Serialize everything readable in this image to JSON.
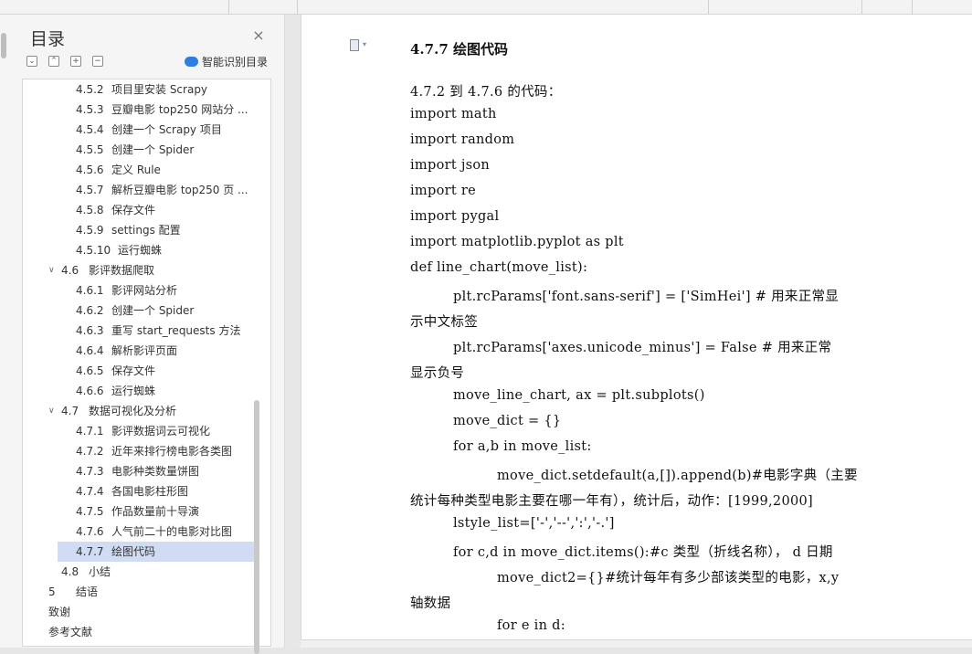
{
  "nav": {
    "title": "目录",
    "smart_toc_label": "智能识别目录",
    "items": [
      {
        "num": "4.5.2",
        "label": "项目里安装 Scrapy",
        "level": 3
      },
      {
        "num": "4.5.3",
        "label": "豆瓣电影 top250 网站分 ...",
        "level": 3
      },
      {
        "num": "4.5.4",
        "label": "创建一个 Scrapy 项目",
        "level": 3
      },
      {
        "num": "4.5.5",
        "label": "创建一个 Spider",
        "level": 3
      },
      {
        "num": "4.5.6",
        "label": "定义 Rule",
        "level": 3
      },
      {
        "num": "4.5.7",
        "label": "解析豆瓣电影 top250 页 ...",
        "level": 3
      },
      {
        "num": "4.5.8",
        "label": "保存文件",
        "level": 3
      },
      {
        "num": "4.5.9",
        "label": "settings 配置",
        "level": 3
      },
      {
        "num": "4.5.10",
        "label": "运行蜘蛛",
        "level": 3
      },
      {
        "num": "4.6",
        "label": "影评数据爬取",
        "level": 2,
        "expanded": true
      },
      {
        "num": "4.6.1",
        "label": "影评网站分析",
        "level": 3
      },
      {
        "num": "4.6.2",
        "label": "创建一个 Spider",
        "level": 3
      },
      {
        "num": "4.6.3",
        "label": "重写 start_requests 方法",
        "level": 3
      },
      {
        "num": "4.6.4",
        "label": "解析影评页面",
        "level": 3
      },
      {
        "num": "4.6.5",
        "label": "保存文件",
        "level": 3
      },
      {
        "num": "4.6.6",
        "label": "运行蜘蛛",
        "level": 3
      },
      {
        "num": "4.7",
        "label": "数据可视化及分析",
        "level": 2,
        "expanded": true
      },
      {
        "num": "4.7.1",
        "label": "影评数据词云可视化",
        "level": 3
      },
      {
        "num": "4.7.2",
        "label": "近年来排行榜电影各类图",
        "level": 3
      },
      {
        "num": "4.7.3",
        "label": "电影种类数量饼图",
        "level": 3
      },
      {
        "num": "4.7.4",
        "label": "各国电影柱形图",
        "level": 3
      },
      {
        "num": "4.7.5",
        "label": "作品数量前十导演",
        "level": 3
      },
      {
        "num": "4.7.6",
        "label": "人气前二十的电影对比图",
        "level": 3
      },
      {
        "num": "4.7.7",
        "label": "绘图代码",
        "level": 3,
        "selected": true
      },
      {
        "num": "4.8",
        "label": "小结",
        "level": 2
      },
      {
        "num": "5",
        "label": "结语",
        "level": 1
      },
      {
        "num": "",
        "label": "致谢",
        "level": 1
      },
      {
        "num": "",
        "label": "参考文献",
        "level": 1
      }
    ]
  },
  "doc": {
    "heading": "4.7.7   绘图代码",
    "lines": [
      {
        "text": "4.7.2 到 4.7.6 的代码：",
        "indent": 0
      },
      {
        "text": "import math",
        "indent": 0
      },
      {
        "text": "import random",
        "indent": 0
      },
      {
        "text": "import json",
        "indent": 0
      },
      {
        "text": "import re",
        "indent": 0
      },
      {
        "text": "import pygal",
        "indent": 0
      },
      {
        "text": "import matplotlib.pyplot as plt",
        "indent": 0
      },
      {
        "text": "def line_chart(move_list):",
        "indent": 0
      },
      {
        "text": "plt.rcParams['font.sans-serif'] = ['SimHei']    # 用来正常显",
        "indent": 1
      },
      {
        "text": "示中文标签",
        "indent": 0
      },
      {
        "text": "plt.rcParams['axes.unicode_minus'] = False    # 用来正常",
        "indent": 1
      },
      {
        "text": "显示负号",
        "indent": 0
      },
      {
        "text": "move_line_chart, ax = plt.subplots()",
        "indent": 1
      },
      {
        "text": "move_dict = {}",
        "indent": 1
      },
      {
        "text": "for a,b in move_list:",
        "indent": 1
      },
      {
        "text": "move_dict.setdefault(a,[]).append(b)#电影字典（主要",
        "indent": 2
      },
      {
        "text": "统计每种类型电影主要在哪一年有），统计后，动作：[1999,2000]",
        "indent": 0
      },
      {
        "text": "lstyle_list=['-','--',':','-.']",
        "indent": 1
      },
      {
        "text": "for c,d in move_dict.items():#c 类型（折线名称）， d 日期",
        "indent": 1
      },
      {
        "text": "move_dict2={}#统计每年有多少部该类型的电影，x,y",
        "indent": 2
      },
      {
        "text": "轴数据",
        "indent": 0
      },
      {
        "text": "for e in d:",
        "indent": 2
      }
    ]
  },
  "colors": {
    "selected_bg": "#cfdcf3",
    "smart_icon": "#2f7de1"
  }
}
